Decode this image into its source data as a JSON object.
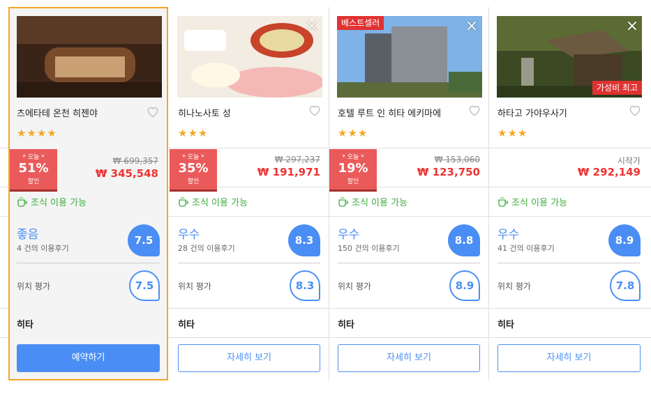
{
  "accent": "#4a8ef5",
  "hotels": [
    {
      "name": "츠에타테 온천 히젠야",
      "stars": "★★★★",
      "discount_top": "* 오늘 *",
      "discount_pct": "51%",
      "discount_bottom": "할인",
      "original_price": "₩ 699,357",
      "price": "₩ 345,548",
      "breakfast": "조식 이용 가능",
      "rating_label": "좋음",
      "review_count": "4 건의 이용후기",
      "score": "7.5",
      "location_label": "위치 평가",
      "location_score": "7.5",
      "city": "히타",
      "button": "예약하기"
    },
    {
      "name": "히나노사토 성",
      "stars": "★★★",
      "close": "×",
      "discount_top": "* 오늘 *",
      "discount_pct": "35%",
      "discount_bottom": "할인",
      "original_price": "₩ 297,237",
      "price": "₩ 191,971",
      "breakfast": "조식 이용 가능",
      "rating_label": "우수",
      "review_count": "28 건의 이용후기",
      "score": "8.3",
      "location_label": "위치 평가",
      "location_score": "8.3",
      "city": "히타",
      "button": "자세히 보기"
    },
    {
      "name": "호텔 루트 인 히타 에키마에",
      "stars": "★★★",
      "close": "×",
      "tag": "베스트셀러",
      "discount_top": "* 오늘 *",
      "discount_pct": "19%",
      "discount_bottom": "할인",
      "original_price": "₩ 153,060",
      "price": "₩ 123,750",
      "breakfast": "조식 이용 가능",
      "rating_label": "우수",
      "review_count": "150 건의 이용후기",
      "score": "8.8",
      "location_label": "위치 평가",
      "location_score": "8.9",
      "city": "히타",
      "button": "자세히 보기"
    },
    {
      "name": "하타고 가야우사기",
      "stars": "★★★",
      "close": "×",
      "tag": "가성비 최고",
      "start_label": "시작가",
      "price": "₩ 292,149",
      "breakfast": "조식 이용 가능",
      "rating_label": "우수",
      "review_count": "41 건의 이용후기",
      "score": "8.9",
      "location_label": "위치 평가",
      "location_score": "7.8",
      "city": "히타",
      "button": "자세히 보기"
    }
  ]
}
